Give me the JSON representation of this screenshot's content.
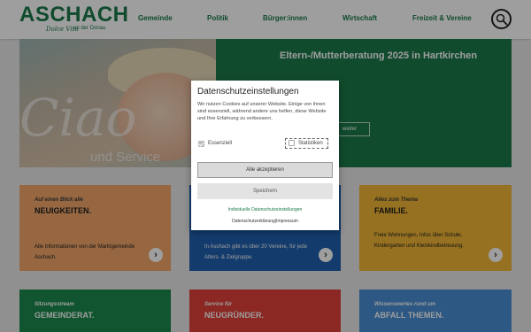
{
  "header": {
    "logo": {
      "text": "ASCHACH",
      "tagline_script": "Dolce Vita",
      "tagline_sub": "an der Donau"
    },
    "nav": [
      "Gemeinde",
      "Politik",
      "Bürger:innen",
      "Wirtschaft",
      "Freizeit & Vereine"
    ],
    "search_icon": "search-icon"
  },
  "hero": {
    "overlay_word": "Ciao",
    "overlay_sub": "und Service",
    "title": "Eltern-/Mutterberatung 2025 in Hartkirchen",
    "more_label": "weiter",
    "green": "#1b7a4a"
  },
  "cards": [
    {
      "subtitle": "Auf einen Blick alle",
      "title": "NEUIGKEITEN.",
      "desc": "Alle Informationen von der Marktgemeinde Aschach.",
      "color": "#f2a66a",
      "text_color": "#1e1e1e",
      "sub_color": "#3a3a3a"
    },
    {
      "subtitle": "",
      "title": "",
      "desc": "In Aschach gibt es über 20 Vereine, für jede Alters- & Zielgruppe.",
      "color": "#1f5fae",
      "text_color": "#ffffff",
      "sub_color": "#ffffff"
    },
    {
      "subtitle": "Alles zum Thema",
      "title": "FAMILIE.",
      "desc": "Freie Wohnungen, Infos über Schule, Kindergarten und Kleinkindbetreuung.",
      "color": "#f2b736",
      "text_color": "#1e1e1e",
      "sub_color": "#3a3a3a"
    },
    {
      "subtitle": "Sitzungsstream",
      "title": "GEMEINDERAT.",
      "desc": "",
      "color": "#1b8a4d",
      "text_color": "#ffffff",
      "sub_color": "#ffffff"
    },
    {
      "subtitle": "Service für",
      "title": "NEUGRÜNDER.",
      "desc": "",
      "color": "#e0413a",
      "text_color": "#ffffff",
      "sub_color": "#ffffff"
    },
    {
      "subtitle": "Wissenswertes rund um",
      "title": "ABFALL THEMEN.",
      "desc": "",
      "color": "#4a8ed3",
      "text_color": "#ffffff",
      "sub_color": "#ffffff"
    }
  ],
  "modal": {
    "title": "Datenschutzeinstellungen",
    "text": "Wir nutzen Cookies auf unserer Website. Einige von ihnen sind essenziell, während andere uns helfen, diese Website und Ihre Erfahrung zu verbessern.",
    "checkbox_essential": "Essenziell",
    "checkbox_stats": "Statistiken",
    "accept_all": "Alle akzeptieren",
    "save": "Speichern",
    "individual_link": "Individuelle Datenschutzeinstellungen",
    "privacy_link": "Datenschutzerklärung",
    "separator": "|",
    "imprint_link": "Impressum"
  }
}
